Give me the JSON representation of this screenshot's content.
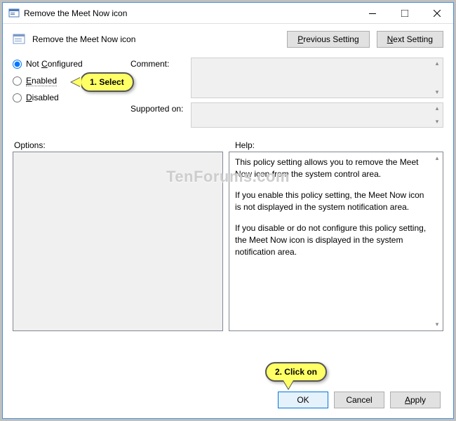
{
  "titlebar": {
    "title": "Remove the Meet Now icon"
  },
  "header": {
    "policy_title": "Remove the Meet Now icon",
    "prev_btn": "Previous Setting",
    "next_btn": "Next Setting"
  },
  "radios": {
    "not_configured": "Not Configured",
    "enabled": "Enabled",
    "disabled": "Disabled",
    "selected": "not_configured"
  },
  "fields": {
    "comment_label": "Comment:",
    "comment_value": "",
    "supported_label": "Supported on:",
    "supported_value": ""
  },
  "panels": {
    "options_label": "Options:",
    "help_label": "Help:",
    "help_text": [
      "This policy setting allows you to remove the Meet Now icon from the system control area.",
      "If you enable this policy setting, the Meet Now icon is not displayed in the system notification area.",
      "If you disable or do not configure this policy setting, the Meet Now icon is displayed in the system notification area."
    ]
  },
  "footer": {
    "ok": "OK",
    "cancel": "Cancel",
    "apply": "Apply"
  },
  "callouts": {
    "select": "1. Select",
    "click": "2. Click on"
  },
  "watermark": "TenForums.com"
}
